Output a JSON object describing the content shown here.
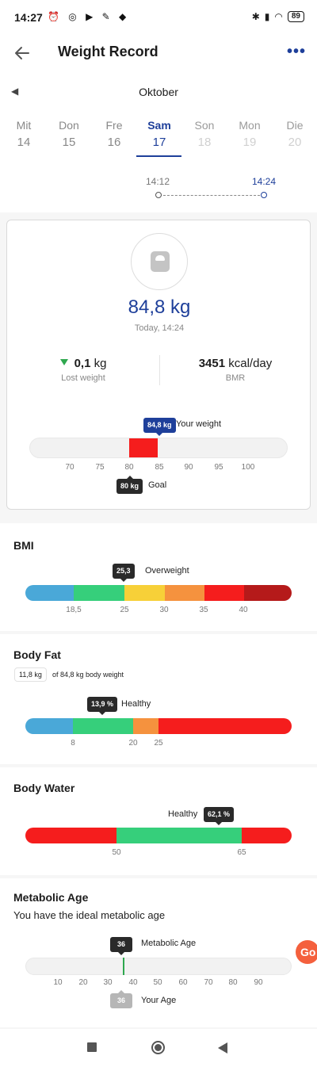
{
  "status_bar": {
    "time": "14:27",
    "battery": "89"
  },
  "header": {
    "title": "Weight Record"
  },
  "date_selector": {
    "month": "Oktober",
    "days": [
      {
        "name": "Mit",
        "date": "14"
      },
      {
        "name": "Don",
        "date": "15"
      },
      {
        "name": "Fre",
        "date": "16"
      },
      {
        "name": "Sam",
        "date": "17"
      },
      {
        "name": "Son",
        "date": "18"
      },
      {
        "name": "Mon",
        "date": "19"
      },
      {
        "name": "Die",
        "date": "20"
      }
    ],
    "selected_index": 3,
    "times": [
      "14:12",
      "14:24"
    ]
  },
  "weight_card": {
    "weight_value": "84,8",
    "weight_unit": "kg",
    "timestamp": "Today, 14:24",
    "lost": {
      "value": "0,1",
      "unit": "kg",
      "label": "Lost weight"
    },
    "bmr": {
      "value": "3451",
      "unit": "kcal/day",
      "label": "BMR"
    },
    "gauge": {
      "ticks": [
        "70",
        "75",
        "80",
        "85",
        "90",
        "95",
        "100"
      ],
      "your_weight_tag": "84,8 kg",
      "your_weight_label": "Your weight",
      "goal_tag": "80 kg",
      "goal_label": "Goal",
      "your_weight": 84.8,
      "goal": 80,
      "colors": {
        "highlight": "#f51d1d",
        "tag_blue": "#1e3f9a"
      }
    }
  },
  "bmi": {
    "title": "BMI",
    "tag": "25,3",
    "status": "Overweight",
    "ticks": [
      "18,5",
      "25",
      "30",
      "35",
      "40"
    ],
    "colors": [
      "#4aa8d8",
      "#36cf7b",
      "#f7d038",
      "#f5923e",
      "#f51d1d",
      "#b51a1a"
    ]
  },
  "body_fat": {
    "title": "Body Fat",
    "chip": "11,8 kg",
    "chip_caption": "of 84,8 kg body weight",
    "tag": "13,9 %",
    "status": "Healthy",
    "ticks": [
      "8",
      "20",
      "25"
    ],
    "colors": [
      "#4aa8d8",
      "#36cf7b",
      "#f5923e",
      "#f51d1d"
    ]
  },
  "body_water": {
    "title": "Body Water",
    "tag": "62,1 %",
    "status": "Healthy",
    "ticks": [
      "50",
      "65"
    ],
    "colors": [
      "#f51d1d",
      "#36cf7b",
      "#f51d1d"
    ]
  },
  "metabolic_age": {
    "title": "Metabolic Age",
    "subtitle": "You have the ideal metabolic age",
    "tag": "36",
    "tag_label": "Metabolic Age",
    "your_age_tag": "36",
    "your_age_label": "Your Age",
    "ticks": [
      "10",
      "20",
      "30",
      "40",
      "50",
      "60",
      "70",
      "80",
      "90"
    ],
    "marker_color": "#2fa84f"
  }
}
